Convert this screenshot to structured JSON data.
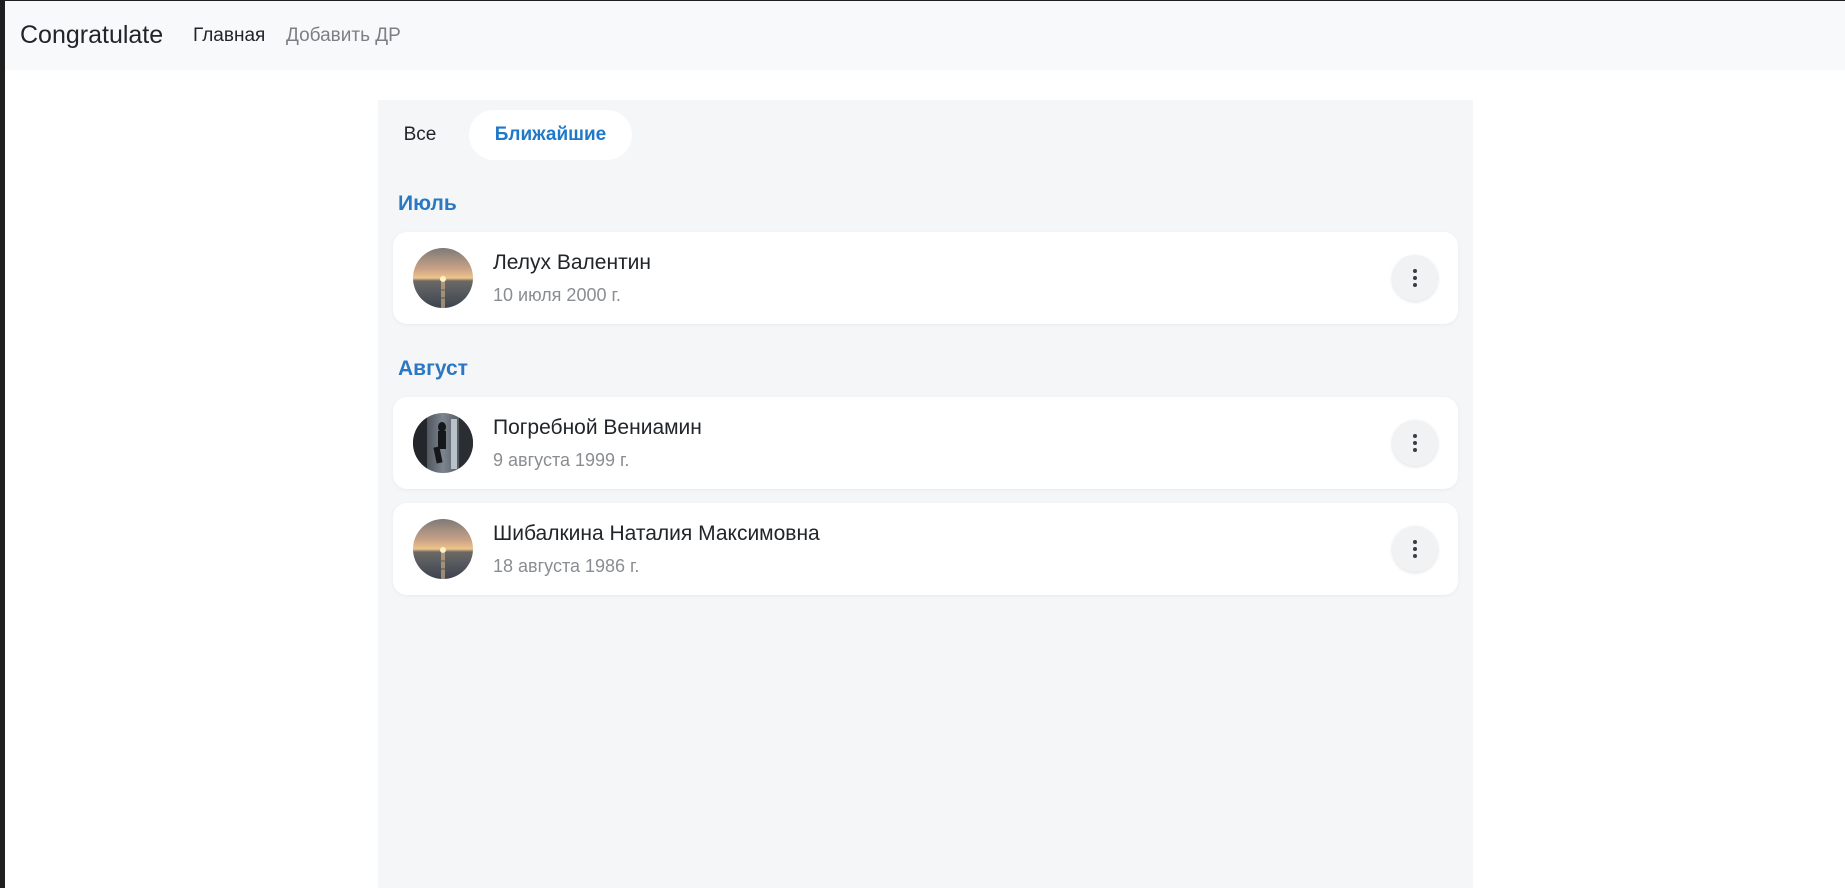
{
  "navbar": {
    "brand": "Congratulate",
    "links": [
      {
        "label": "Главная",
        "active": true
      },
      {
        "label": "Добавить ДР",
        "active": false
      }
    ]
  },
  "tabs": [
    {
      "label": "Все",
      "active": false
    },
    {
      "label": "Ближайшие",
      "active": true
    }
  ],
  "groups": [
    {
      "month": "Июль",
      "people": [
        {
          "name": "Лелух Валентин",
          "date": "10 июля 2000 г.",
          "avatar": "sunset-photo"
        }
      ]
    },
    {
      "month": "Август",
      "people": [
        {
          "name": "Погребной Вениамин",
          "date": "9 августа 1999 г.",
          "avatar": "silhouette-photo"
        },
        {
          "name": "Шибалкина Наталия Максимовна",
          "date": "18 августа 1986 г.",
          "avatar": "sunset-photo"
        }
      ]
    }
  ],
  "icons": {
    "menu": "more-vertical-icon"
  },
  "colors": {
    "accent": "#1f78c8",
    "panel": "#f5f6f8",
    "navbar": "#f8f9fa"
  }
}
